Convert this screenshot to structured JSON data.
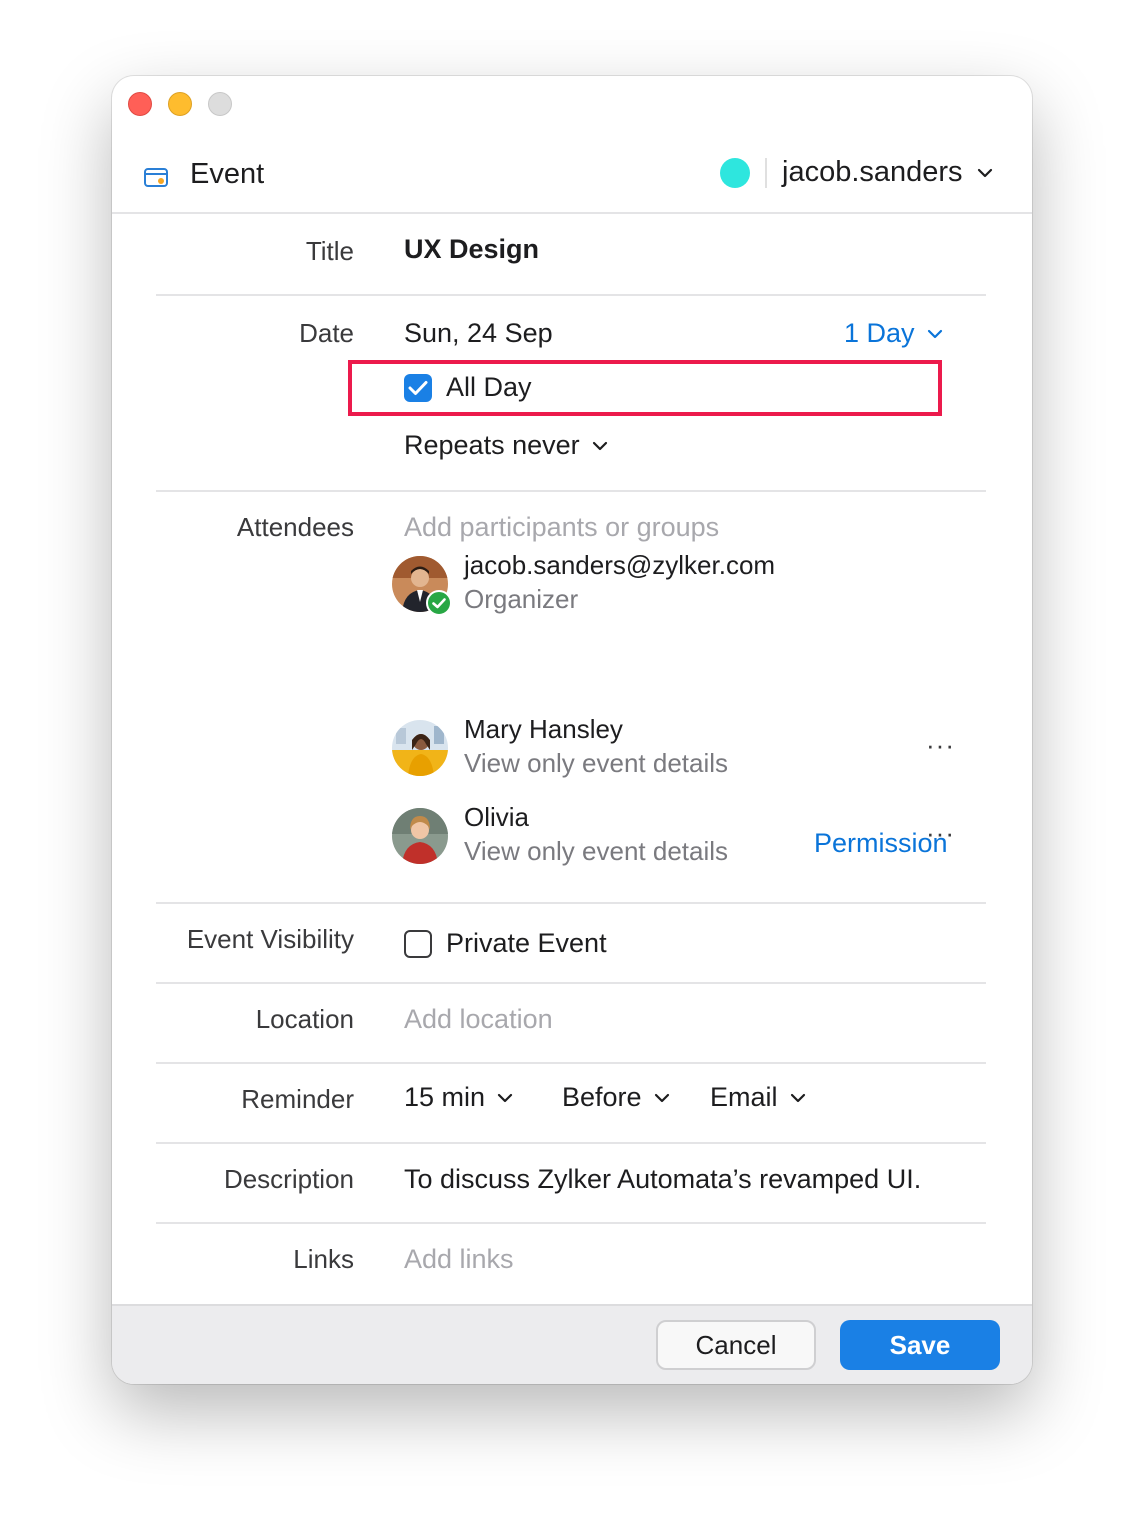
{
  "window": {
    "header_title": "Event",
    "account_name": "jacob.sanders",
    "status_color": "#2ee6de"
  },
  "fields": {
    "title_label": "Title",
    "title_value": "UX Design",
    "date_label": "Date",
    "date_value": "Sun, 24 Sep",
    "duration": "1 Day",
    "all_day_label": "All Day",
    "all_day_checked": true,
    "repeats": "Repeats never",
    "attendees_label": "Attendees",
    "attendees_placeholder": "Add participants or groups",
    "visibility_label": "Event Visibility",
    "private_event_label": "Private Event",
    "private_event_checked": false,
    "location_label": "Location",
    "location_placeholder": "Add location",
    "reminder_label": "Reminder",
    "reminder_time": "15 min",
    "reminder_relation": "Before",
    "reminder_method": "Email",
    "description_label": "Description",
    "description_value": "To discuss Zylker Automata’s revamped UI.",
    "links_label": "Links",
    "links_placeholder": "Add links"
  },
  "attendees": [
    {
      "name": "jacob.sanders@zylker.com",
      "role": "Organizer"
    },
    {
      "name": "Mary Hansley",
      "role": "View only event details"
    },
    {
      "name": "Olivia",
      "role": "View only event details"
    }
  ],
  "more_label": "···",
  "permission_link": "Permission",
  "buttons": {
    "cancel": "Cancel",
    "save": "Save"
  },
  "colors": {
    "accent": "#1a80e5",
    "link": "#0a74d9",
    "highlight": "#ec1a4c",
    "accepted": "#28a745"
  }
}
